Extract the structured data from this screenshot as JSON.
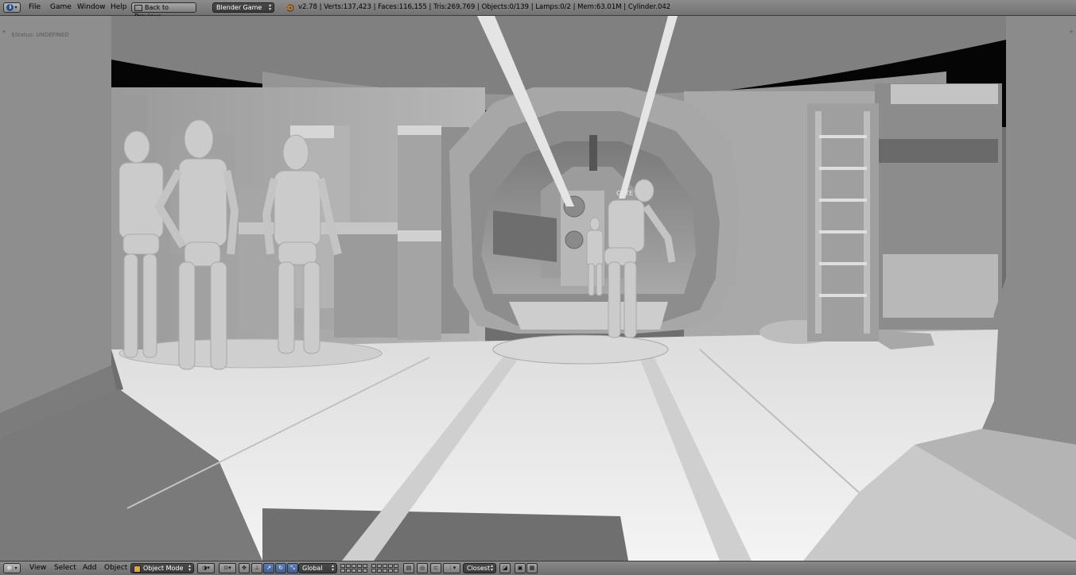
{
  "top_header": {
    "menu": [
      "File",
      "Game",
      "Window",
      "Help"
    ],
    "back_button": "Back to Previous",
    "engine": "Blender Game",
    "stats": "v2.78 | Verts:137,423 | Faces:116,155 | Tris:269,769 | Objects:0/139 | Lamps:0/2 | Mem:63.01M | Cylinder.042"
  },
  "viewport": {
    "status": "$Status: UNDEFINED",
    "gate_label": "GATE"
  },
  "bottom_header": {
    "menu": [
      "View",
      "Select",
      "Add",
      "Object"
    ],
    "mode": "Object Mode",
    "orientation": "Global",
    "snap": "Closest"
  },
  "icons": {
    "editor_type": "info-icon",
    "engine_logo": "blender-logo-icon",
    "viewport_editor": "3d-view-icon",
    "mode_icon": "object-cube-icon",
    "shading": "viewport-shading-icon",
    "pivot": "pivot-point-icon",
    "manipulator": "manipulator-icon",
    "translate": "translate-icon",
    "rotate": "rotate-icon",
    "scale": "scale-icon",
    "proportional": "proportional-edit-icon",
    "snap_icon": "snap-magnet-icon",
    "render": "render-icon",
    "render_anim": "render-animation-icon"
  },
  "colors": {
    "header": "#7f7f7f",
    "active_button": "#4a6ca8",
    "select_bg": "#404040"
  }
}
